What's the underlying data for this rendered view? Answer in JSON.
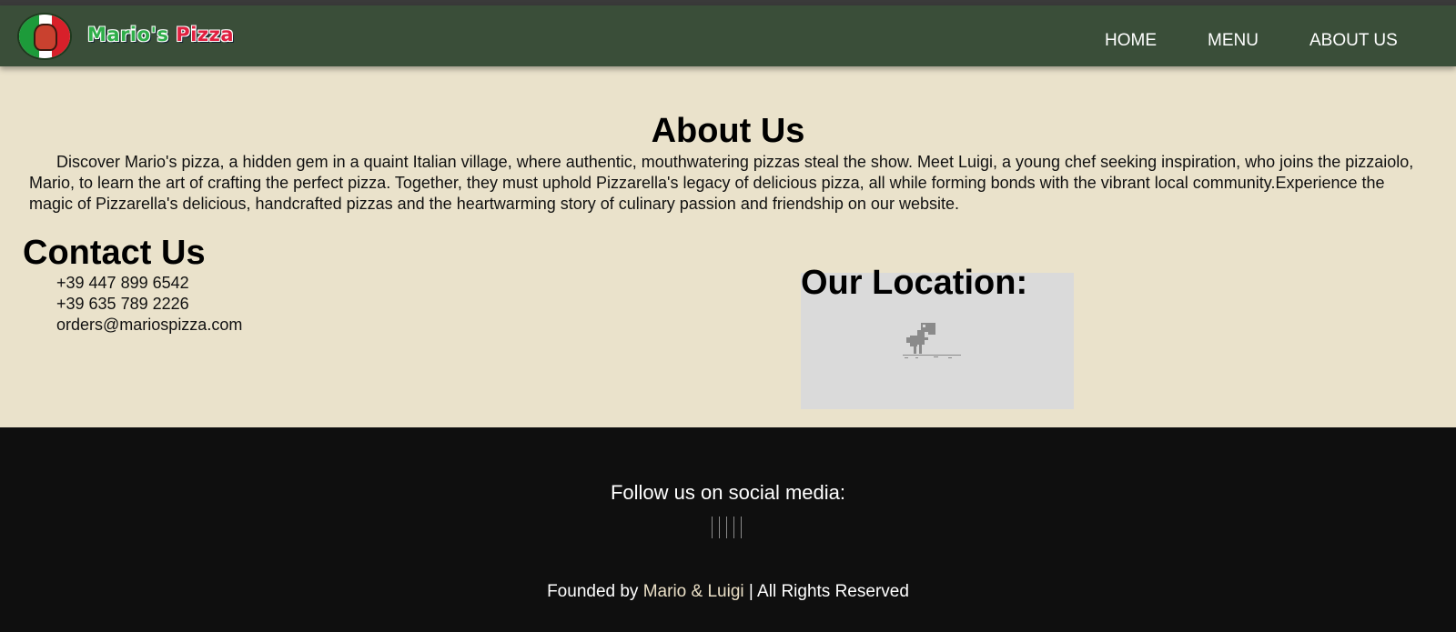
{
  "header": {
    "brand_part1": "Mario's",
    "brand_part2": "Pizza",
    "nav": [
      {
        "label": "HOME"
      },
      {
        "label": "MENU"
      },
      {
        "label": "ABOUT US"
      }
    ]
  },
  "about": {
    "title": "About Us",
    "text": "Discover Mario's pizza, a hidden gem in a quaint Italian village, where authentic, mouthwatering pizzas steal the show. Meet Luigi, a young chef seeking inspiration, who joins the pizzaiolo, Mario, to learn the art of crafting the perfect pizza. Together, they must uphold Pizzarella's legacy of delicious pizza, all while forming bonds with the vibrant local community.Experience the magic of Pizzarella's delicious, handcrafted pizzas and the heartwarming story of culinary passion and friendship on our website."
  },
  "contact": {
    "title": "Contact Us",
    "phone1": "+39 447 899 6542",
    "phone2": "+39 635 789 2226",
    "email": "orders@mariospizza.com"
  },
  "location": {
    "title": "Our Location:",
    "map_icon": "offline-dino-icon"
  },
  "footer": {
    "follow_text": "Follow us on social media:",
    "social_icons": [
      "social-icon",
      "social-icon",
      "social-icon",
      "social-icon",
      "social-icon"
    ],
    "founded_prefix": "Founded by",
    "founded_names": "Mario & Luigi",
    "founded_suffix": "| All Rights Reserved"
  },
  "colors": {
    "nav_bg": "#3a4e39",
    "page_bg": "#eae2cb",
    "footer_bg": "#0f0f0f",
    "founder_accent": "#eadfc6"
  }
}
